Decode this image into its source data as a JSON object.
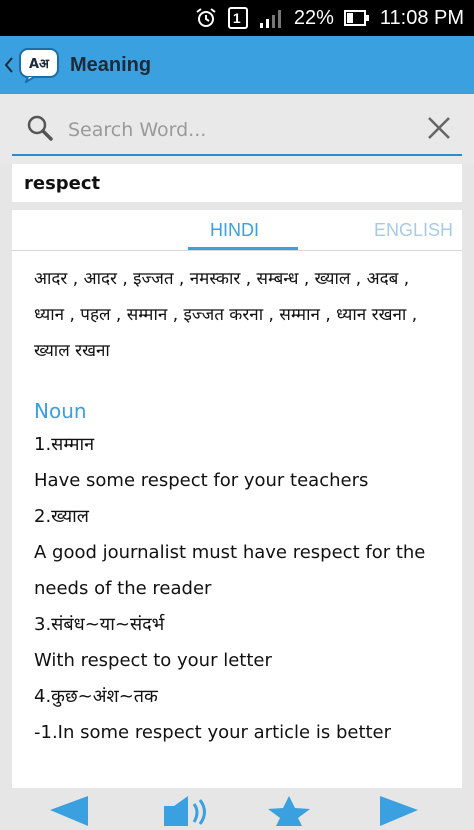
{
  "status_bar": {
    "sim_badge": "1",
    "battery": "22%",
    "time": "11:08 PM"
  },
  "app_bar": {
    "title": "Meaning",
    "logo_text": "Aअ"
  },
  "search": {
    "placeholder": "Search Word..."
  },
  "word": "respect",
  "tabs": [
    {
      "label": "HINDI"
    },
    {
      "label": "ENGLISH"
    }
  ],
  "hindi_meanings": "आदर , आदर , इज्जत , नमस्कार , सम्बन्ध , ख्याल , अदब , ध्यान , पहल , सम्मान , इज्जत करना , सम्मान , ध्यान रखना , ख्याल रखना",
  "part_of_speech": "Noun",
  "lines": [
    "1.सम्मान",
    "Have some respect for your teachers",
    "2.ख्याल",
    "A good journalist must have respect for the needs of the reader",
    "3.संबंध~या~संदर्भ",
    "With respect to your letter",
    "4.कुछ~अंश~तक",
    "-1.In some respect your article is better"
  ],
  "colors": {
    "accent": "#3aa0df",
    "app_bar": "#3aa0df"
  }
}
